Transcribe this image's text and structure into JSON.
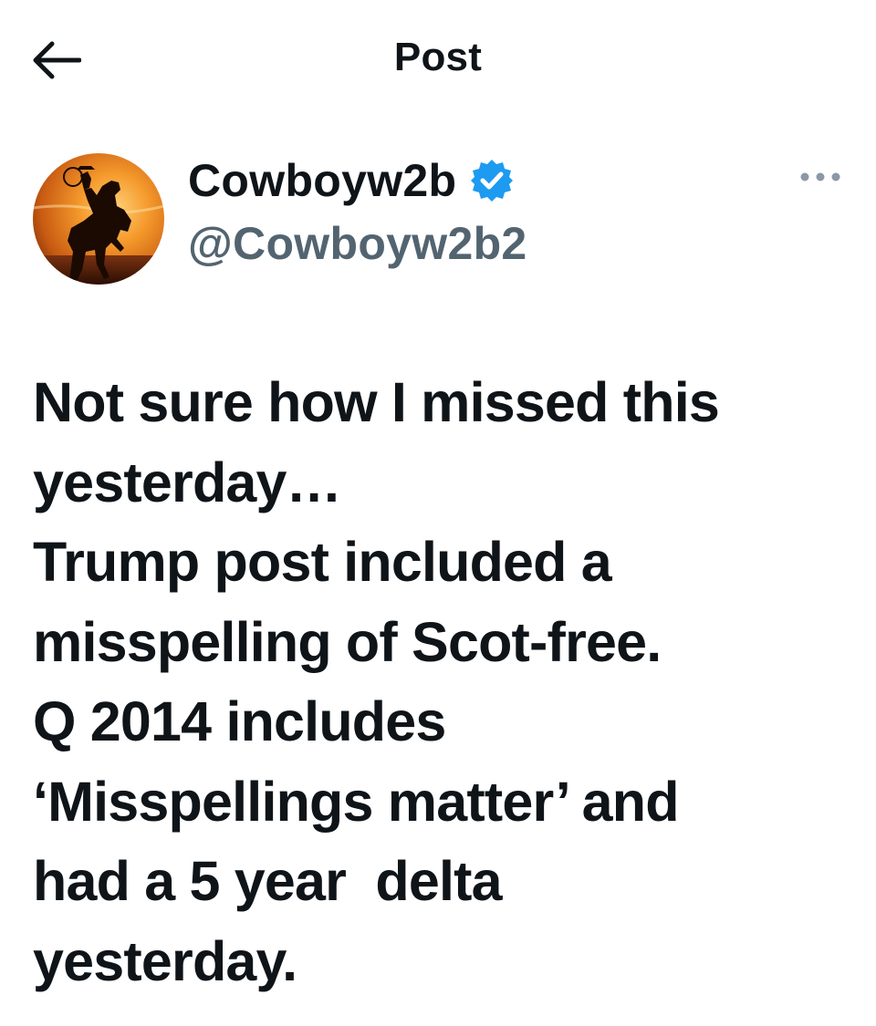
{
  "header": {
    "title": "Post"
  },
  "author": {
    "display_name": "Cowboyw2b",
    "handle": "@Cowboyw2b2",
    "verified_color": "#1d9bf0"
  },
  "post": {
    "lines": [
      "Not sure how I missed this",
      "yesterday…",
      "Trump post included a",
      "misspelling of Scot-free.",
      "Q 2014 includes",
      "‘Misspellings matter’ and",
      "had a 5 year  delta",
      "yesterday."
    ]
  },
  "icons": {
    "back": "arrow-left-icon",
    "verified": "verified-badge-icon",
    "more": "more-horizontal-icon"
  }
}
